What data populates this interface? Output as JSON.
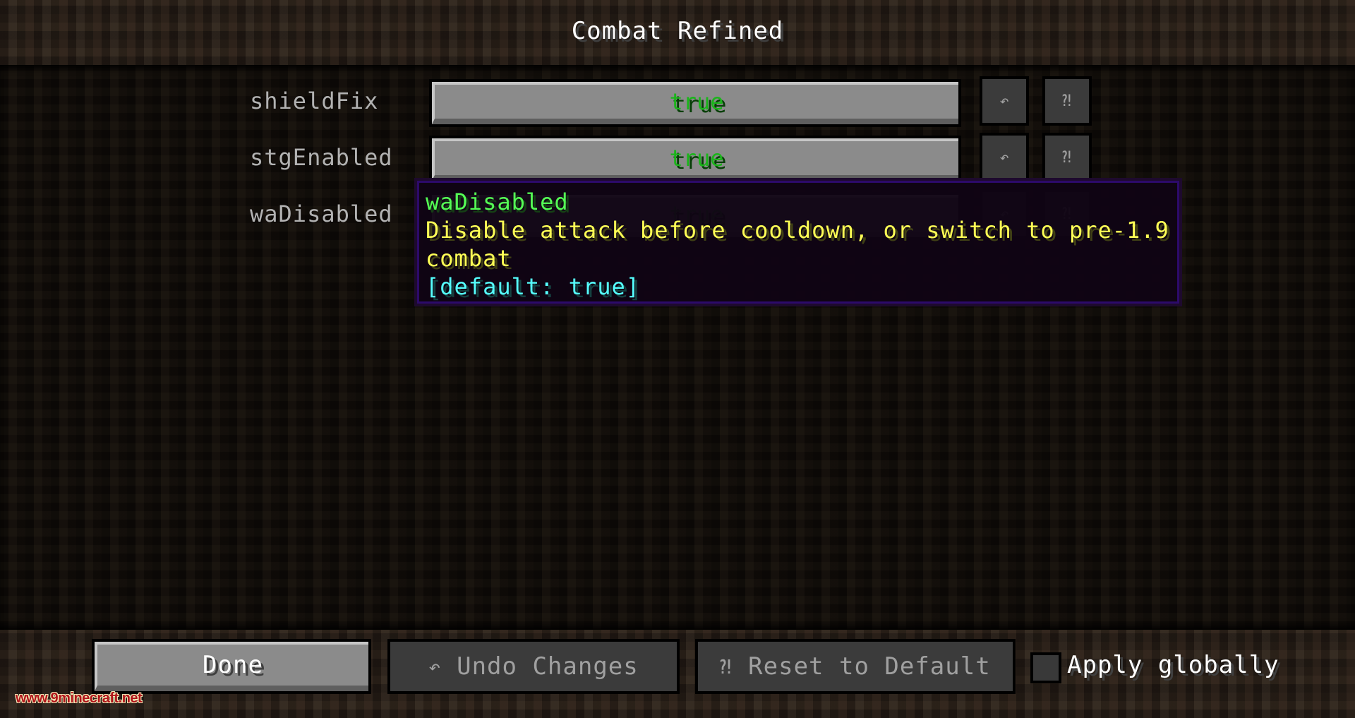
{
  "screen": {
    "title": "Combat Refined"
  },
  "config_entries": [
    {
      "key": "shieldFix",
      "value": "true",
      "undo_icon": "undo-arrow-icon",
      "reset_icon": "reset-default-icon"
    },
    {
      "key": "stgEnabled",
      "value": "true",
      "undo_icon": "undo-arrow-icon",
      "reset_icon": "reset-default-icon"
    },
    {
      "key": "waDisabled",
      "value": "true",
      "undo_icon": "undo-arrow-icon",
      "reset_icon": "reset-default-icon"
    }
  ],
  "icons": {
    "undo": "↶",
    "reset": "⁈"
  },
  "tooltip": {
    "title": "waDisabled",
    "description_line1": "Disable attack before cooldown, or switch to pre-1.9",
    "description_line2": "combat",
    "default": "[default: true]"
  },
  "footer": {
    "done_label": "Done",
    "undo_label": "Undo Changes",
    "reset_label": "Reset to Default",
    "apply_globally_label": "Apply globally",
    "apply_globally_checked": false
  },
  "colors": {
    "value_true": "#1bb51b",
    "tooltip_title": "#55ff55",
    "tooltip_desc": "#ffff55",
    "tooltip_default": "#55ffff"
  },
  "watermark": "www.9minecraft.net"
}
